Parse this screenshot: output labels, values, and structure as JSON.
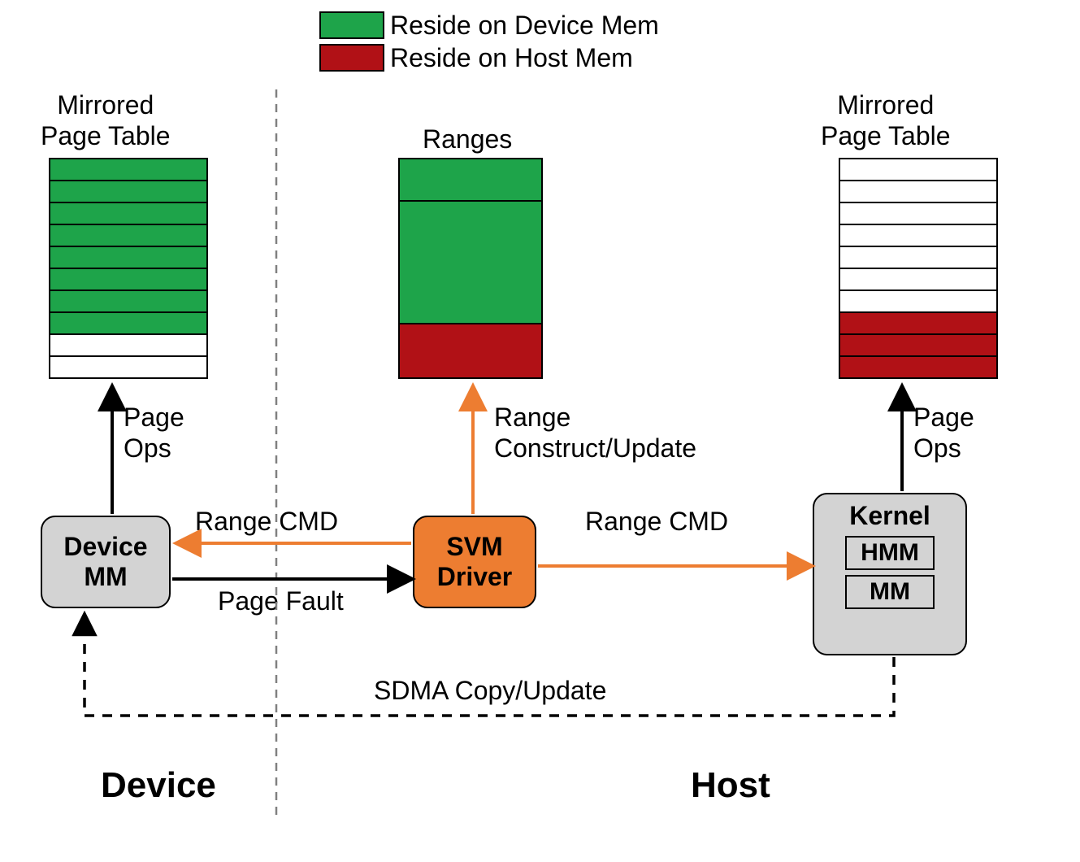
{
  "colors": {
    "green": "#1ea44a",
    "red": "#b11116",
    "orange": "#ed7d31",
    "gray": "#d3d3d3",
    "black": "#000000",
    "white": "#ffffff"
  },
  "legend": {
    "device_mem": "Reside on Device Mem",
    "host_mem": "Reside on Host Mem"
  },
  "titles": {
    "left_table": "Mirrored\nPage Table",
    "right_table": "Mirrored\nPage Table",
    "ranges": "Ranges"
  },
  "tables": {
    "left": {
      "rows": 10,
      "fills": [
        "green",
        "green",
        "green",
        "green",
        "green",
        "green",
        "green",
        "green",
        "white",
        "white"
      ]
    },
    "right": {
      "rows": 10,
      "fills": [
        "white",
        "white",
        "white",
        "white",
        "white",
        "white",
        "white",
        "red",
        "red",
        "red"
      ]
    }
  },
  "ranges": {
    "segments": [
      {
        "fill": "green",
        "flex": 1
      },
      {
        "fill": "green",
        "flex": 3
      },
      {
        "fill": "red",
        "flex": 1.3
      }
    ]
  },
  "nodes": {
    "device_mm": {
      "line1": "Device",
      "line2": "MM"
    },
    "svm_driver": {
      "line1": "SVM",
      "line2": "Driver"
    },
    "kernel": {
      "title": "Kernel",
      "sub1": "HMM",
      "sub2": "MM"
    }
  },
  "edges": {
    "page_ops_left": "Page\nOps",
    "page_ops_right": "Page\nOps",
    "range_construct": "Range\nConstruct/Update",
    "range_cmd_left": "Range CMD",
    "range_cmd_right": "Range CMD",
    "page_fault": "Page Fault",
    "sdma": "SDMA Copy/Update"
  },
  "zones": {
    "device": "Device",
    "host": "Host"
  }
}
